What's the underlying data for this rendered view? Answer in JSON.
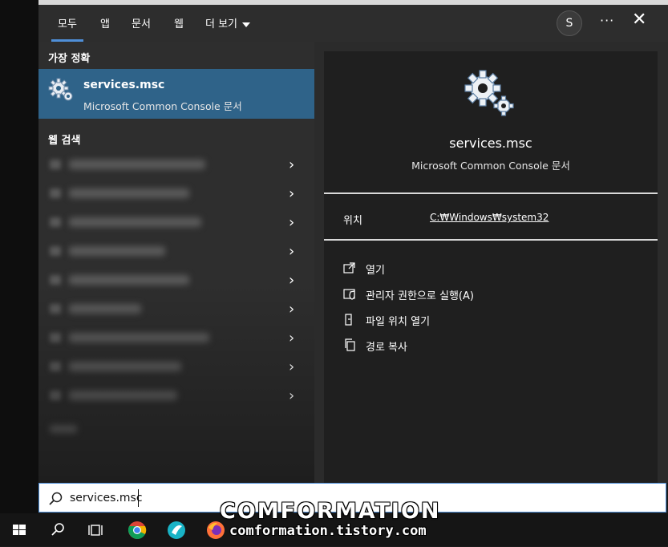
{
  "tabs": [
    {
      "label": "모두",
      "active": true
    },
    {
      "label": "앱"
    },
    {
      "label": "문서"
    },
    {
      "label": "웹"
    },
    {
      "label": "더 보기"
    }
  ],
  "account_initial": "S",
  "more_options": "···",
  "close": "✕",
  "best_match": {
    "section_title": "가장 정확",
    "name": "services.msc",
    "subtitle": "Microsoft Common Console 문서"
  },
  "web_search": {
    "section_title": "웹 검색",
    "rows": 9
  },
  "detail": {
    "title": "services.msc",
    "subtitle": "Microsoft Common Console 문서",
    "location_label": "위치",
    "location_value": "C:₩Windows₩system32",
    "actions": [
      {
        "label": "열기",
        "icon": "open-icon"
      },
      {
        "label": "관리자 권한으로 실행(A)",
        "icon": "shield-icon"
      },
      {
        "label": "파일 위치 열기",
        "icon": "folder-location-icon"
      },
      {
        "label": "경로 복사",
        "icon": "copy-icon"
      }
    ]
  },
  "search": {
    "value": "services.msc"
  },
  "watermark": {
    "line1": "COMFORMATION",
    "line2": "comformation.tistory.com"
  },
  "colors": {
    "accent": "#4f8fd8",
    "selected": "#2f6389"
  }
}
